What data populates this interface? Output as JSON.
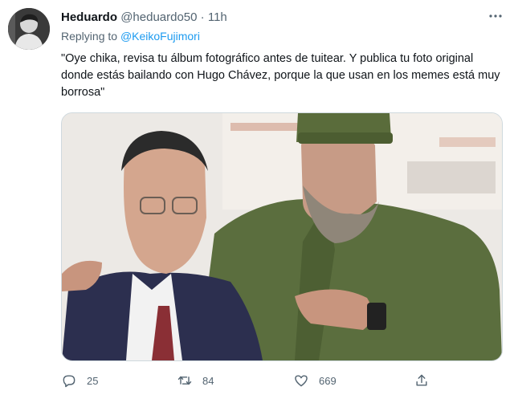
{
  "tweet": {
    "author_name": "Heduardo",
    "author_handle": "@heduardo50",
    "separator": "·",
    "time": "11h",
    "replying_to_prefix": "Replying to",
    "replying_to_handle": "@KeikoFujimori",
    "text": "\"Oye chika, revisa tu álbum fotográfico antes de tuitear. Y publica tu foto original donde estás bailando con Hugo Chávez, porque la que usan en los memes está muy borrosa\""
  },
  "actions": {
    "reply_count": "25",
    "retweet_count": "84",
    "like_count": "669"
  },
  "icons": [
    "more-icon",
    "reply-icon",
    "retweet-icon",
    "like-icon",
    "share-icon"
  ],
  "colors": {
    "link": "#1d9bf0",
    "secondary_text": "#536471",
    "primary_text": "#0f1419"
  }
}
